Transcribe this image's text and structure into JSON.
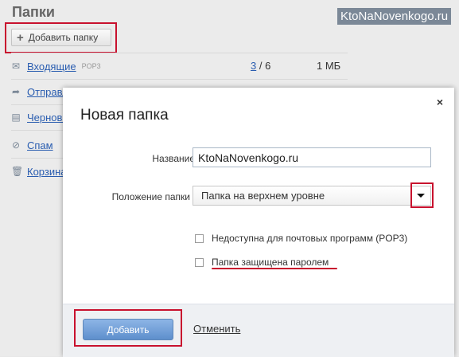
{
  "background": {
    "title": "Папки",
    "add_folder_label": "Добавить папку",
    "watermark": "KtoNaNovenkogo.ru",
    "folders": [
      {
        "label": "Входящие",
        "tag": "POP3",
        "unread": "3",
        "total": "/ 6",
        "size": "1 МБ",
        "icon": "inbox-icon"
      },
      {
        "label": "Отправленные",
        "icon": "sent-icon"
      },
      {
        "label": "Черновики",
        "icon": "drafts-icon"
      },
      {
        "label": "Спам",
        "icon": "spam-icon"
      },
      {
        "label": "Корзина",
        "icon": "trash-icon"
      }
    ]
  },
  "dialog": {
    "title": "Новая папка",
    "close_label": "×",
    "name_label": "Название",
    "name_value": "KtoNaNovenkogo.ru",
    "position_label": "Положение папки",
    "position_value": "Папка на верхнем уровне",
    "checkbox_pop3_label": "Недоступна для почтовых программ (POP3)",
    "checkbox_password_label": "Папка защищена паролем",
    "add_button": "Добавить",
    "cancel_link": "Отменить"
  },
  "colors": {
    "highlight": "#c8112e",
    "link": "#2a5db0",
    "primary_button": "#6f9bd5"
  }
}
